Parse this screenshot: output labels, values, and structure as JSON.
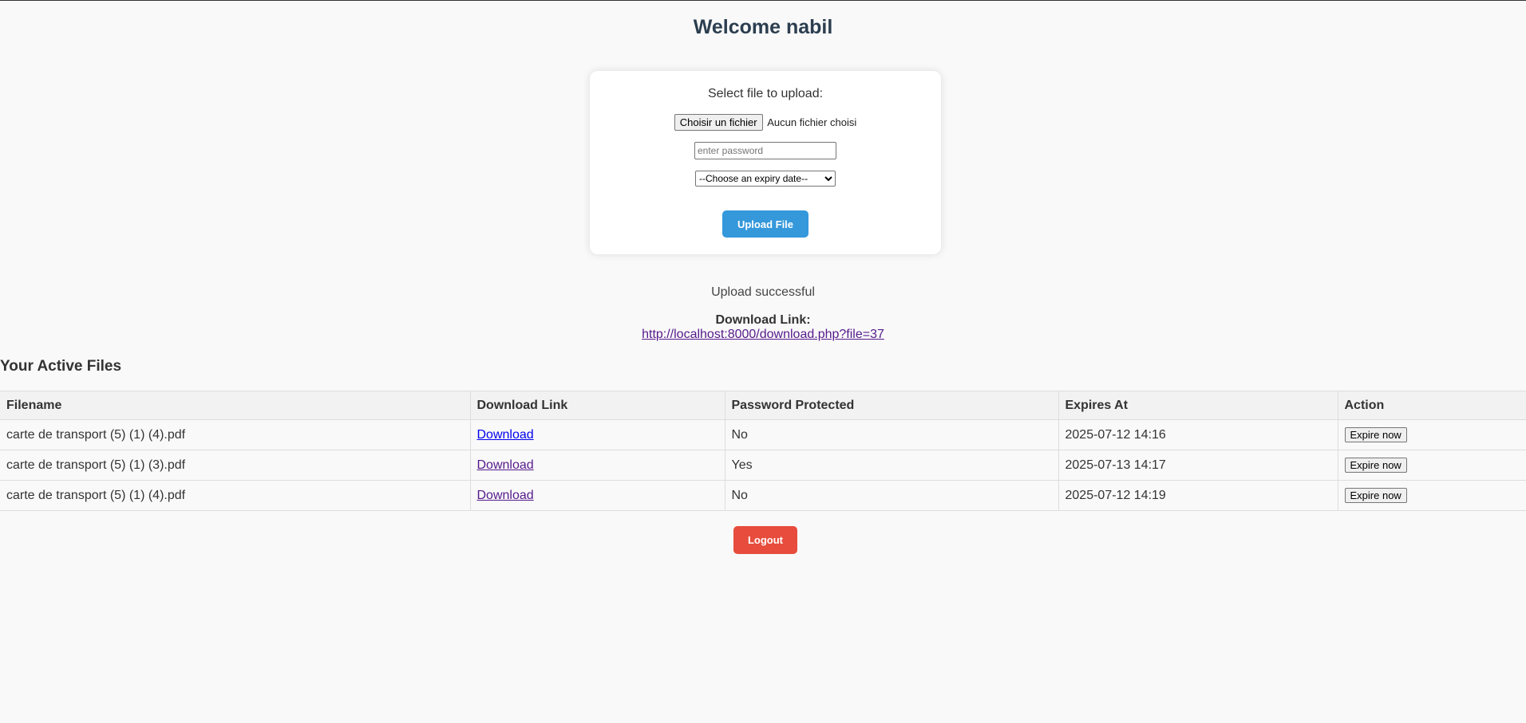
{
  "header": {
    "welcome": "Welcome nabil"
  },
  "upload_form": {
    "select_label": "Select file to upload:",
    "file_button_label": "Choisir un fichier",
    "file_status": "Aucun fichier choisi",
    "password_placeholder": "enter password",
    "password_value": "",
    "expiry_selected": "--Choose an expiry date--",
    "upload_button_label": "Upload File"
  },
  "result": {
    "status": "Upload successful",
    "download_label": "Download Link:",
    "download_url": "http://localhost:8000/download.php?file=37"
  },
  "files_section": {
    "title": "Your Active Files",
    "columns": [
      "Filename",
      "Download Link",
      "Password Protected",
      "Expires At",
      "Action"
    ],
    "rows": [
      {
        "filename": "carte de transport (5) (1) (4).pdf",
        "link_label": "Download",
        "protected": "No",
        "expires": "2025-07-12 14:16",
        "action_label": "Expire now"
      },
      {
        "filename": "carte de transport (5) (1) (3).pdf",
        "link_label": "Download",
        "protected": "Yes",
        "expires": "2025-07-13 14:17",
        "action_label": "Expire now"
      },
      {
        "filename": "carte de transport (5) (1) (4).pdf",
        "link_label": "Download",
        "protected": "No",
        "expires": "2025-07-12 14:19",
        "action_label": "Expire now"
      }
    ]
  },
  "footer": {
    "logout_label": "Logout"
  },
  "colors": {
    "upload_button": "#3498db",
    "logout_button": "#e74c3c",
    "heading": "#2c3e50",
    "link_unvisited": "#0000ee",
    "link_visited": "#551a8b"
  }
}
